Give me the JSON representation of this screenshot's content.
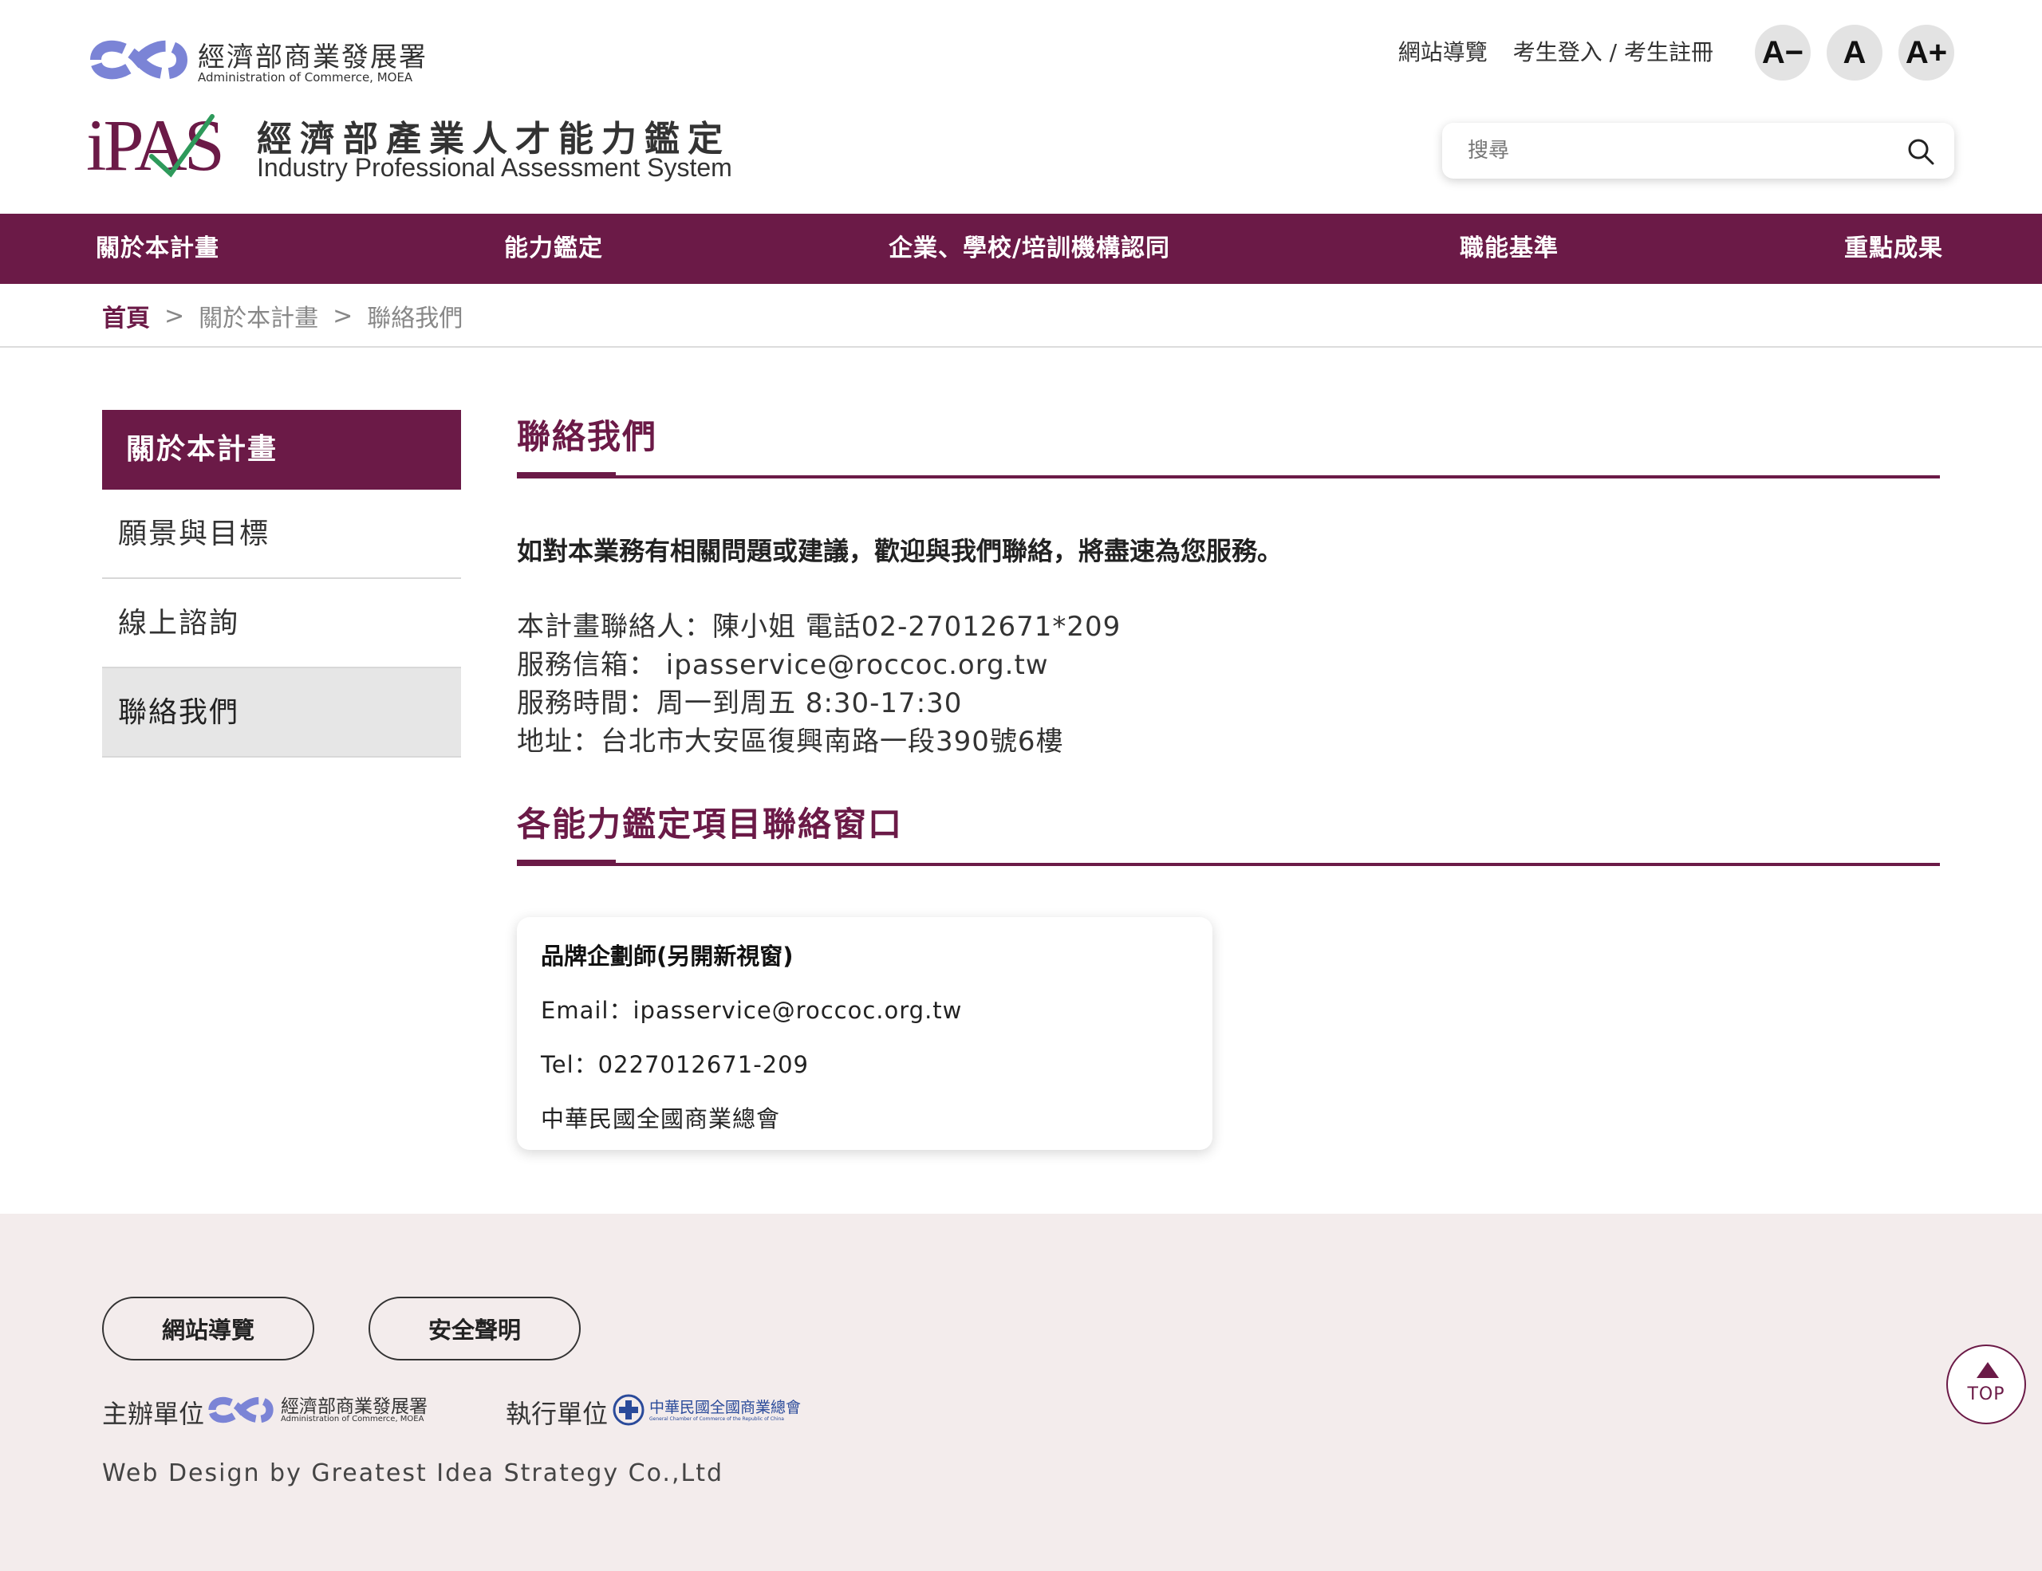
{
  "brand": {
    "moea_name": "經濟部商業發展署",
    "moea_en": "Administration of Commerce, MOEA",
    "ipas_mark": "iPAS",
    "ipas_name": "經濟部產業人才能力鑑定",
    "ipas_en": "Industry Professional Assessment System",
    "accent_color": "#6b1a47"
  },
  "utility": {
    "sitemap": "網站導覽",
    "login": "考生登入 / 考生註冊",
    "font_small": "A−",
    "font_normal": "A",
    "font_large": "A+"
  },
  "search": {
    "placeholder": "搜尋",
    "value": "",
    "icon": "search-icon"
  },
  "nav": {
    "items": [
      {
        "label": "關於本計畫"
      },
      {
        "label": "能力鑑定"
      },
      {
        "label": "企業、學校/培訓機構認同"
      },
      {
        "label": "職能基準"
      },
      {
        "label": "重點成果"
      }
    ]
  },
  "breadcrumb": {
    "home": "首頁",
    "sep": ">",
    "parent": "關於本計畫",
    "current": "聯絡我們"
  },
  "sidebar": {
    "heading": "關於本計畫",
    "items": [
      {
        "label": "願景與目標"
      },
      {
        "label": "線上諮詢"
      },
      {
        "label": "聯絡我們"
      }
    ]
  },
  "main": {
    "title": "聯絡我們",
    "intro": "如對本業務有相關問題或建議，歡迎與我們聯絡，將盡速為您服務。",
    "contact_person": "本計畫聯絡人：陳小姐 電話02-27012671*209",
    "email": "服務信箱： ipasservice@roccoc.org.tw",
    "hours": "服務時間：周一到周五 8:30-17:30",
    "address": "地址：台北市大安區復興南路一段390號6樓",
    "windows_title": "各能力鑑定項目聯絡窗口",
    "card": {
      "title": "品牌企劃師(另開新視窗)",
      "email": "Email：ipasservice@roccoc.org.tw",
      "tel": "Tel：0227012671-209",
      "org": "中華民國全國商業總會"
    }
  },
  "footer": {
    "sitemap_btn": "網站導覽",
    "security_btn": "安全聲明",
    "host_label": "主辦單位",
    "host_name": "經濟部商業發展署",
    "host_en": "Administration of Commerce, MOEA",
    "exec_label": "執行單位",
    "exec_name": "中華民國全國商業總會",
    "exec_en": "General Chamber of Commerce of the Republic of China",
    "credit": "Web Design by  Greatest Idea Strategy Co.,Ltd",
    "top_label": "TOP"
  }
}
